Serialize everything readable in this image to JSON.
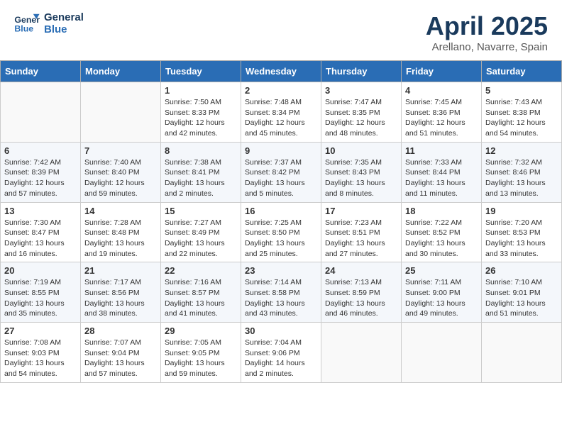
{
  "header": {
    "logo_line1": "General",
    "logo_line2": "Blue",
    "month_title": "April 2025",
    "location": "Arellano, Navarre, Spain"
  },
  "weekdays": [
    "Sunday",
    "Monday",
    "Tuesday",
    "Wednesday",
    "Thursday",
    "Friday",
    "Saturday"
  ],
  "weeks": [
    [
      {
        "day": "",
        "info": ""
      },
      {
        "day": "",
        "info": ""
      },
      {
        "day": "1",
        "info": "Sunrise: 7:50 AM\nSunset: 8:33 PM\nDaylight: 12 hours and 42 minutes."
      },
      {
        "day": "2",
        "info": "Sunrise: 7:48 AM\nSunset: 8:34 PM\nDaylight: 12 hours and 45 minutes."
      },
      {
        "day": "3",
        "info": "Sunrise: 7:47 AM\nSunset: 8:35 PM\nDaylight: 12 hours and 48 minutes."
      },
      {
        "day": "4",
        "info": "Sunrise: 7:45 AM\nSunset: 8:36 PM\nDaylight: 12 hours and 51 minutes."
      },
      {
        "day": "5",
        "info": "Sunrise: 7:43 AM\nSunset: 8:38 PM\nDaylight: 12 hours and 54 minutes."
      }
    ],
    [
      {
        "day": "6",
        "info": "Sunrise: 7:42 AM\nSunset: 8:39 PM\nDaylight: 12 hours and 57 minutes."
      },
      {
        "day": "7",
        "info": "Sunrise: 7:40 AM\nSunset: 8:40 PM\nDaylight: 12 hours and 59 minutes."
      },
      {
        "day": "8",
        "info": "Sunrise: 7:38 AM\nSunset: 8:41 PM\nDaylight: 13 hours and 2 minutes."
      },
      {
        "day": "9",
        "info": "Sunrise: 7:37 AM\nSunset: 8:42 PM\nDaylight: 13 hours and 5 minutes."
      },
      {
        "day": "10",
        "info": "Sunrise: 7:35 AM\nSunset: 8:43 PM\nDaylight: 13 hours and 8 minutes."
      },
      {
        "day": "11",
        "info": "Sunrise: 7:33 AM\nSunset: 8:44 PM\nDaylight: 13 hours and 11 minutes."
      },
      {
        "day": "12",
        "info": "Sunrise: 7:32 AM\nSunset: 8:46 PM\nDaylight: 13 hours and 13 minutes."
      }
    ],
    [
      {
        "day": "13",
        "info": "Sunrise: 7:30 AM\nSunset: 8:47 PM\nDaylight: 13 hours and 16 minutes."
      },
      {
        "day": "14",
        "info": "Sunrise: 7:28 AM\nSunset: 8:48 PM\nDaylight: 13 hours and 19 minutes."
      },
      {
        "day": "15",
        "info": "Sunrise: 7:27 AM\nSunset: 8:49 PM\nDaylight: 13 hours and 22 minutes."
      },
      {
        "day": "16",
        "info": "Sunrise: 7:25 AM\nSunset: 8:50 PM\nDaylight: 13 hours and 25 minutes."
      },
      {
        "day": "17",
        "info": "Sunrise: 7:23 AM\nSunset: 8:51 PM\nDaylight: 13 hours and 27 minutes."
      },
      {
        "day": "18",
        "info": "Sunrise: 7:22 AM\nSunset: 8:52 PM\nDaylight: 13 hours and 30 minutes."
      },
      {
        "day": "19",
        "info": "Sunrise: 7:20 AM\nSunset: 8:53 PM\nDaylight: 13 hours and 33 minutes."
      }
    ],
    [
      {
        "day": "20",
        "info": "Sunrise: 7:19 AM\nSunset: 8:55 PM\nDaylight: 13 hours and 35 minutes."
      },
      {
        "day": "21",
        "info": "Sunrise: 7:17 AM\nSunset: 8:56 PM\nDaylight: 13 hours and 38 minutes."
      },
      {
        "day": "22",
        "info": "Sunrise: 7:16 AM\nSunset: 8:57 PM\nDaylight: 13 hours and 41 minutes."
      },
      {
        "day": "23",
        "info": "Sunrise: 7:14 AM\nSunset: 8:58 PM\nDaylight: 13 hours and 43 minutes."
      },
      {
        "day": "24",
        "info": "Sunrise: 7:13 AM\nSunset: 8:59 PM\nDaylight: 13 hours and 46 minutes."
      },
      {
        "day": "25",
        "info": "Sunrise: 7:11 AM\nSunset: 9:00 PM\nDaylight: 13 hours and 49 minutes."
      },
      {
        "day": "26",
        "info": "Sunrise: 7:10 AM\nSunset: 9:01 PM\nDaylight: 13 hours and 51 minutes."
      }
    ],
    [
      {
        "day": "27",
        "info": "Sunrise: 7:08 AM\nSunset: 9:03 PM\nDaylight: 13 hours and 54 minutes."
      },
      {
        "day": "28",
        "info": "Sunrise: 7:07 AM\nSunset: 9:04 PM\nDaylight: 13 hours and 57 minutes."
      },
      {
        "day": "29",
        "info": "Sunrise: 7:05 AM\nSunset: 9:05 PM\nDaylight: 13 hours and 59 minutes."
      },
      {
        "day": "30",
        "info": "Sunrise: 7:04 AM\nSunset: 9:06 PM\nDaylight: 14 hours and 2 minutes."
      },
      {
        "day": "",
        "info": ""
      },
      {
        "day": "",
        "info": ""
      },
      {
        "day": "",
        "info": ""
      }
    ]
  ]
}
